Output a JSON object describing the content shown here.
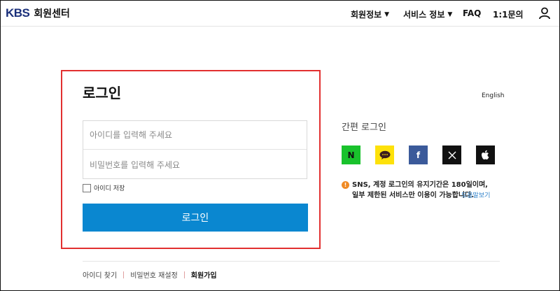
{
  "header": {
    "logo_mark": "KBS",
    "logo_text": "회원센터",
    "nav": [
      {
        "label": "회원정보",
        "caret": "▼"
      },
      {
        "label": "서비스 정보",
        "caret": "▼"
      },
      {
        "label": "FAQ",
        "caret": ""
      },
      {
        "label": "1:1문의",
        "caret": ""
      }
    ],
    "user_icon": "user-icon"
  },
  "login": {
    "title": "로그인",
    "id_placeholder": "아이디를 입력해 주세요",
    "pw_placeholder": "비밀번호를 입력해 주세요",
    "remember_label": "아이디 저장",
    "submit_label": "로그인"
  },
  "language_link": "English",
  "simple_login": {
    "title": "간편 로그인",
    "providers": [
      {
        "name": "naver-icon",
        "glyph": "N",
        "color": "#19c22c",
        "fg": "#111111"
      },
      {
        "name": "kakao-icon",
        "glyph": "●",
        "color": "#fde10a",
        "fg": "#3c1e1e"
      },
      {
        "name": "facebook-icon",
        "glyph": "f",
        "color": "#3b5a9a",
        "fg": "#ffffff"
      },
      {
        "name": "x-icon",
        "glyph": "𝕏",
        "color": "#111111",
        "fg": "#ffffff"
      },
      {
        "name": "apple-icon",
        "glyph": "",
        "color": "#111111",
        "fg": "#ffffff"
      }
    ],
    "note": "SNS, 계정 로그인의 유지기간은 180일이며, 일부 제한된 서비스만 이용이 가능합니다.",
    "help_link": "도움말보기"
  },
  "footer_links": {
    "find_id": "아이디 찾기",
    "reset_pw": "비밀번호 재설정",
    "signup": "회원가입"
  },
  "colors": {
    "accent": "#0a87d0",
    "highlight_border": "#e23030",
    "logo": "#1a2f7a"
  }
}
